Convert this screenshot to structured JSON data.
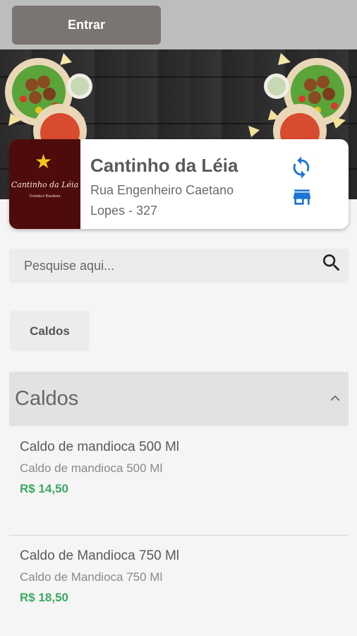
{
  "header": {
    "login_label": "Entrar"
  },
  "store": {
    "name": "Cantinho da Léia",
    "address": "Rua Engenheiro Caetano Lopes - 327",
    "logo_script": "Cantinho da Léia",
    "logo_subtitle": "Comida é Brasileira"
  },
  "search": {
    "placeholder": "Pesquise aqui..."
  },
  "categories": [
    {
      "label": "Caldos"
    }
  ],
  "section": {
    "title": "Caldos"
  },
  "items": [
    {
      "name": "Caldo de mandioca 500 Ml",
      "description": "Caldo de mandioca 500 Ml",
      "price": "R$ 14,50"
    },
    {
      "name": "Caldo de Mandioca 750 Ml",
      "description": "Caldo de Mandioca 750 Ml",
      "price": "R$ 18,50"
    }
  ],
  "colors": {
    "accent_blue": "#1976d2",
    "price_green": "#3aa962",
    "logo_bg": "#4e0b0b",
    "topbar_bg": "#bdbdbd"
  },
  "icons": [
    "sync-icon",
    "storefront-icon",
    "search-icon",
    "chevron-up-icon",
    "star-icon"
  ]
}
